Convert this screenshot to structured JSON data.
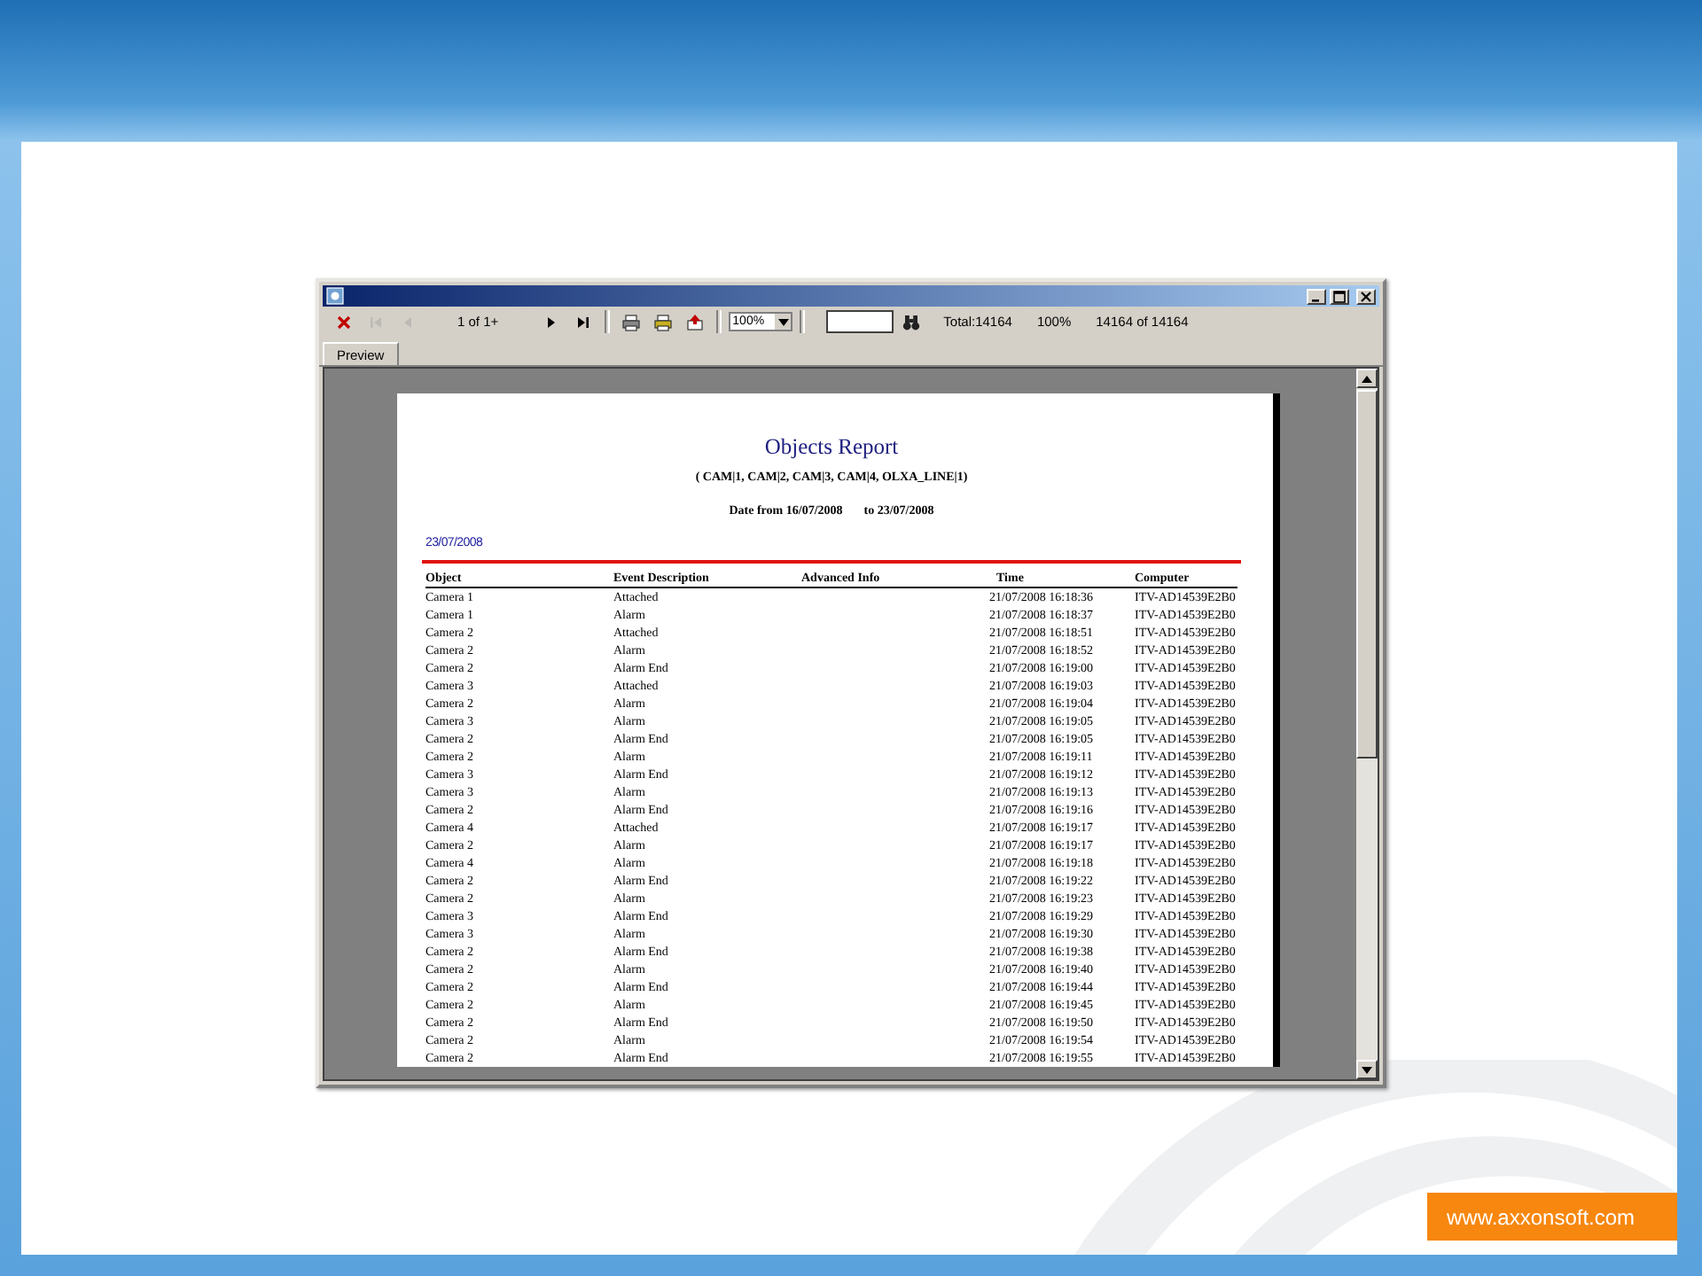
{
  "toolbar": {
    "buttons": [
      {
        "kind": "close",
        "disabled": false
      },
      {
        "kind": "first",
        "disabled": true
      },
      {
        "kind": "prev",
        "disabled": true
      },
      {
        "kind": "pages",
        "label": "1 of 1+"
      },
      {
        "kind": "next",
        "disabled": false
      },
      {
        "kind": "last",
        "disabled": false
      },
      {
        "kind": "separator"
      },
      {
        "kind": "print",
        "disabled": false
      },
      {
        "kind": "setup",
        "disabled": false
      },
      {
        "kind": "export",
        "disabled": false
      },
      {
        "kind": "separator"
      }
    ],
    "zoom": "100%",
    "status": [
      "Total:14164",
      "100%",
      "14164 of 14164"
    ]
  },
  "tabs": [
    {
      "label": "Preview",
      "selected": true
    }
  ],
  "report": {
    "title": "Objects Report",
    "subtitle": "( CAM|1, CAM|2, CAM|3, CAM|4, OLXA_LINE|1)",
    "date_from": "Date from 16/07/2008",
    "date_to": "to 23/07/2008",
    "group_date": "23/07/2008",
    "columns": [
      "Object",
      "Event Description",
      "Advanced Info",
      "Time",
      "Computer"
    ],
    "rows": [
      {
        "object": "Camera 1",
        "event": "Attached",
        "time": "21/07/2008 16:18:36",
        "computer": "ITV-AD14539E2B0"
      },
      {
        "object": "Camera 1",
        "event": "Alarm",
        "time": "21/07/2008 16:18:37",
        "computer": "ITV-AD14539E2B0"
      },
      {
        "object": "Camera 2",
        "event": "Attached",
        "time": "21/07/2008 16:18:51",
        "computer": "ITV-AD14539E2B0"
      },
      {
        "object": "Camera 2",
        "event": "Alarm",
        "time": "21/07/2008 16:18:52",
        "computer": "ITV-AD14539E2B0"
      },
      {
        "object": "Camera 2",
        "event": "Alarm End",
        "time": "21/07/2008 16:19:00",
        "computer": "ITV-AD14539E2B0"
      },
      {
        "object": "Camera 3",
        "event": "Attached",
        "time": "21/07/2008 16:19:03",
        "computer": "ITV-AD14539E2B0"
      },
      {
        "object": "Camera 2",
        "event": "Alarm",
        "time": "21/07/2008 16:19:04",
        "computer": "ITV-AD14539E2B0"
      },
      {
        "object": "Camera 3",
        "event": "Alarm",
        "time": "21/07/2008 16:19:05",
        "computer": "ITV-AD14539E2B0"
      },
      {
        "object": "Camera 2",
        "event": "Alarm End",
        "time": "21/07/2008 16:19:05",
        "computer": "ITV-AD14539E2B0"
      },
      {
        "object": "Camera 2",
        "event": "Alarm",
        "time": "21/07/2008 16:19:11",
        "computer": "ITV-AD14539E2B0"
      },
      {
        "object": "Camera 3",
        "event": "Alarm End",
        "time": "21/07/2008 16:19:12",
        "computer": "ITV-AD14539E2B0"
      },
      {
        "object": "Camera 3",
        "event": "Alarm",
        "time": "21/07/2008 16:19:13",
        "computer": "ITV-AD14539E2B0"
      },
      {
        "object": "Camera 2",
        "event": "Alarm End",
        "time": "21/07/2008 16:19:16",
        "computer": "ITV-AD14539E2B0"
      },
      {
        "object": "Camera 4",
        "event": "Attached",
        "time": "21/07/2008 16:19:17",
        "computer": "ITV-AD14539E2B0"
      },
      {
        "object": "Camera 2",
        "event": "Alarm",
        "time": "21/07/2008 16:19:17",
        "computer": "ITV-AD14539E2B0"
      },
      {
        "object": "Camera 4",
        "event": "Alarm",
        "time": "21/07/2008 16:19:18",
        "computer": "ITV-AD14539E2B0"
      },
      {
        "object": "Camera 2",
        "event": "Alarm End",
        "time": "21/07/2008 16:19:22",
        "computer": "ITV-AD14539E2B0"
      },
      {
        "object": "Camera 2",
        "event": "Alarm",
        "time": "21/07/2008 16:19:23",
        "computer": "ITV-AD14539E2B0"
      },
      {
        "object": "Camera 3",
        "event": "Alarm End",
        "time": "21/07/2008 16:19:29",
        "computer": "ITV-AD14539E2B0"
      },
      {
        "object": "Camera 3",
        "event": "Alarm",
        "time": "21/07/2008 16:19:30",
        "computer": "ITV-AD14539E2B0"
      },
      {
        "object": "Camera 2",
        "event": "Alarm End",
        "time": "21/07/2008 16:19:38",
        "computer": "ITV-AD14539E2B0"
      },
      {
        "object": "Camera 2",
        "event": "Alarm",
        "time": "21/07/2008 16:19:40",
        "computer": "ITV-AD14539E2B0"
      },
      {
        "object": "Camera 2",
        "event": "Alarm End",
        "time": "21/07/2008 16:19:44",
        "computer": "ITV-AD14539E2B0"
      },
      {
        "object": "Camera 2",
        "event": "Alarm",
        "time": "21/07/2008 16:19:45",
        "computer": "ITV-AD14539E2B0"
      },
      {
        "object": "Camera 2",
        "event": "Alarm End",
        "time": "21/07/2008 16:19:50",
        "computer": "ITV-AD14539E2B0"
      },
      {
        "object": "Camera 2",
        "event": "Alarm",
        "time": "21/07/2008 16:19:54",
        "computer": "ITV-AD14539E2B0"
      },
      {
        "object": "Camera 2",
        "event": "Alarm End",
        "time": "21/07/2008 16:19:55",
        "computer": "ITV-AD14539E2B0"
      }
    ]
  },
  "footer": {
    "link": "www.axxonsoft.com"
  }
}
